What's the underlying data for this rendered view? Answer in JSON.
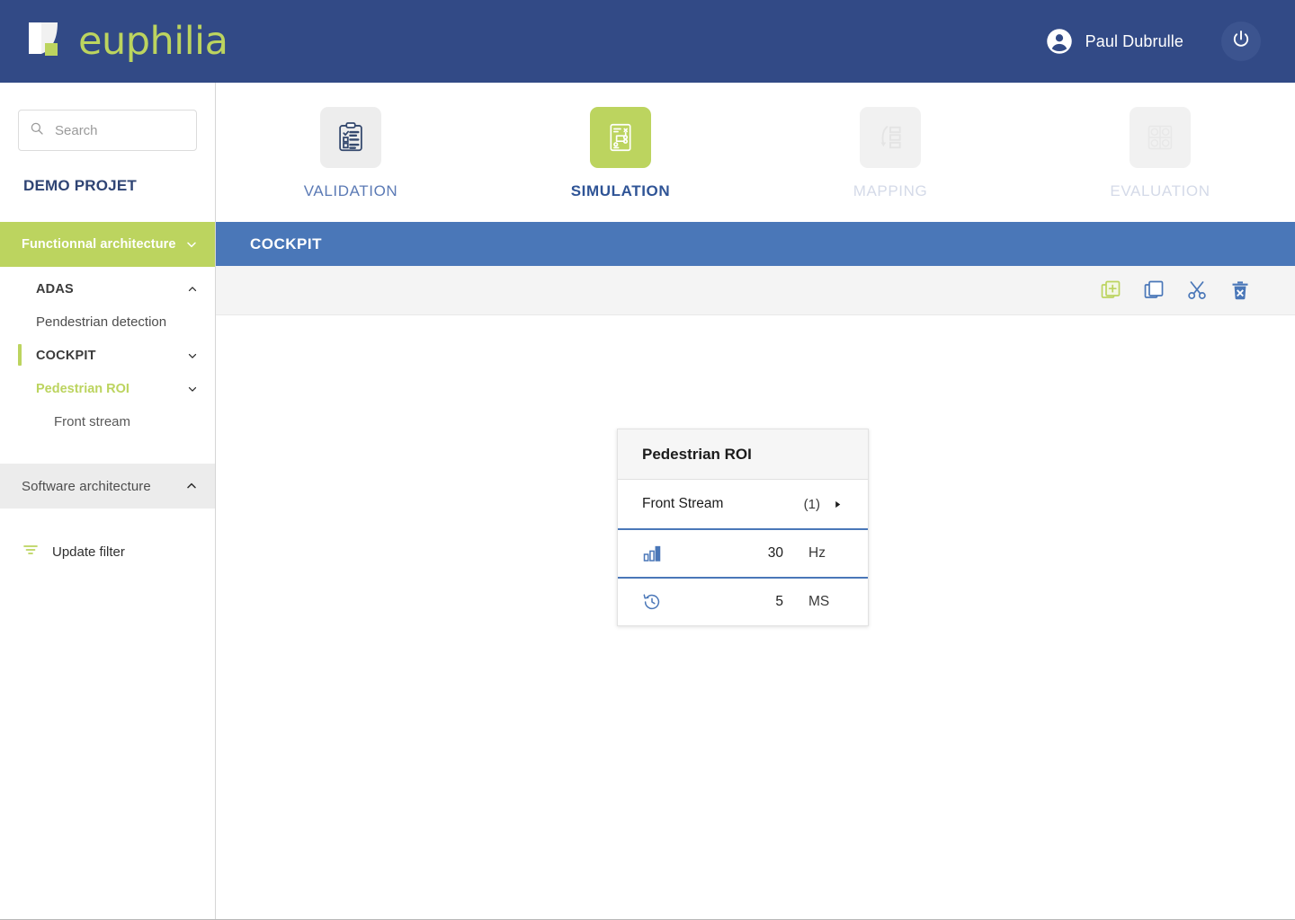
{
  "header": {
    "brand": "euphilia",
    "logo_icon": "euphilia-logo-mark",
    "user_icon": "account-circle-icon",
    "user_name": "Paul Dubrulle",
    "power_icon": "power-icon",
    "bg_color": "#324a86",
    "brand_color": "#bcd45f"
  },
  "sidebar": {
    "search": {
      "icon": "search-icon",
      "placeholder": "Search",
      "value": ""
    },
    "project_title": "DEMO PROJET",
    "sections": [
      {
        "label": "Functionnal architecture",
        "state": "expanded",
        "style": "green",
        "chevron": "chevron-down-icon"
      },
      {
        "label": "Software architecture",
        "state": "collapsed",
        "style": "grey",
        "chevron": "chevron-up-icon"
      }
    ],
    "tree": [
      {
        "label": "ADAS",
        "level": 1,
        "chevron": "chevron-up-icon",
        "accent": false,
        "highlight": false
      },
      {
        "label": "Pendestrian detection",
        "level": 2,
        "chevron": "",
        "accent": false,
        "highlight": false
      },
      {
        "label": "COCKPIT",
        "level": 1,
        "chevron": "chevron-down-icon",
        "accent": true,
        "highlight": false
      },
      {
        "label": "Pedestrian ROI",
        "level": 2,
        "chevron": "chevron-down-icon",
        "accent": false,
        "highlight": true
      },
      {
        "label": "Front stream",
        "level": 3,
        "chevron": "",
        "accent": false,
        "highlight": false
      }
    ],
    "update_filter": {
      "label": "Update filter",
      "icon": "filter-icon"
    }
  },
  "tabs": [
    {
      "label": "VALIDATION",
      "icon": "clipboard-check-icon",
      "state": "idle"
    },
    {
      "label": "SIMULATION",
      "icon": "flowchart-document-icon",
      "state": "active"
    },
    {
      "label": "MAPPING",
      "icon": "mapping-arrow-list-icon",
      "state": "disabled"
    },
    {
      "label": "EVALUATION",
      "icon": "evaluation-grid-icon",
      "state": "disabled"
    }
  ],
  "page": {
    "title": "COCKPIT",
    "title_bar_color": "#4a77b8"
  },
  "toolbar": {
    "actions": [
      {
        "name": "add-icon",
        "label": "Add",
        "color": "#bcd45f"
      },
      {
        "name": "copy-icon",
        "label": "Copy",
        "color": "#4a77b8"
      },
      {
        "name": "cut-icon",
        "label": "Cut",
        "color": "#4a77b8"
      },
      {
        "name": "delete-icon",
        "label": "Delete",
        "color": "#4a77b8"
      }
    ]
  },
  "card": {
    "title": "Pedestrian ROI",
    "stream": {
      "label": "Front Stream",
      "count": "(1)",
      "caret": "caret-right-icon"
    },
    "metrics": [
      {
        "icon": "bar-chart-icon",
        "value": "30",
        "unit": "Hz"
      },
      {
        "icon": "history-clock-icon",
        "value": "5",
        "unit": "MS"
      }
    ]
  }
}
